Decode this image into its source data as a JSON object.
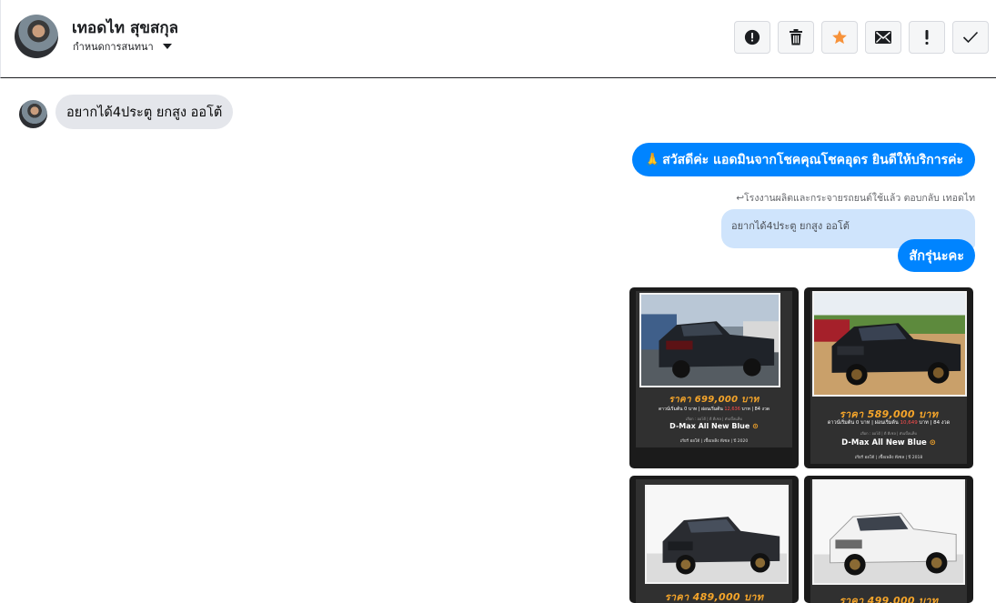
{
  "header": {
    "contact_name": "เทอดไท สุขสกุล",
    "subtitle": "กำหนดการสนทนา",
    "actions": [
      {
        "icon": "alert-circle-icon"
      },
      {
        "icon": "trash-icon"
      },
      {
        "icon": "star-icon",
        "color": "#f7923a"
      },
      {
        "icon": "envelope-icon"
      },
      {
        "icon": "exclamation-icon"
      },
      {
        "icon": "check-icon"
      }
    ]
  },
  "chat": {
    "incoming_message": "อยากได้4ประตู ยกสูง ออโต้",
    "greeting_emoji": "🙏",
    "greeting": "สวัสดีค่ะ แอดมินจากโชคคุณโชคอุดร ยินดีให้บริการค่ะ",
    "reply_note": "โรงงานผลิตและกระจายรถยนต์ใช้แล้ว ตอบกลับ เทอดไท",
    "quoted_message": "อยากได้4ประตู ยกสูง ออโต้",
    "reply_message": "สักรุ่นะคะ"
  },
  "cards": [
    {
      "price": "ราคา 699,000 บาท",
      "terms_prefix": "ดาวน์เริ่มต้น 0 บาท | ผ่อนเริ่มต้น",
      "installment": "12,636",
      "terms_suffix": "บาท | 84 งวด",
      "tag": "เลือก : ออโต้ | ดี ดีเซล | ดับเบิ้ลแค็บ",
      "model": "D-Max All New Blue",
      "specs": "เกียร์ ออโต้  |  เชื้อเพลิง ดีเซล  |  ปี 2020",
      "paint": "#1f2329"
    },
    {
      "price": "ราคา 589,000 บาท",
      "terms_prefix": "ดาวน์เริ่มต้น 0 บาท | ผ่อนเริ่มต้น",
      "installment": "10,649",
      "terms_suffix": "บาท | 84 งวด",
      "tag": "เลือก : ออโต้ | ดี ดีเซล | ดับเบิ้ลแค็บ",
      "model": "D-Max All New Blue",
      "specs": "เกียร์ ออโต้  |  เชื้อเพลิง ดีเซล  |  ปี 2018",
      "paint": "#1a1c20"
    },
    {
      "price": "ราคา 489,000 บาท",
      "paint": "#2a2c31"
    },
    {
      "price": "ราคา 499,000 บาท",
      "paint": "#f2f2f2"
    }
  ]
}
